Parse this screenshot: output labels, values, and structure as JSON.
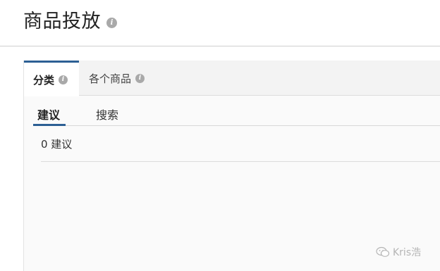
{
  "header": {
    "title": "商品投放",
    "info_icon": "info-icon"
  },
  "tabs": [
    {
      "label": "分类",
      "active": true,
      "icon": "info-icon"
    },
    {
      "label": "各个商品",
      "active": false,
      "icon": "info-icon"
    }
  ],
  "subtabs": [
    {
      "label": "建议",
      "active": true
    },
    {
      "label": "搜索",
      "active": false
    }
  ],
  "results": {
    "summary": "0 建议"
  },
  "watermark": {
    "text": "Kris浩",
    "icon": "wechat-icon"
  },
  "colors": {
    "accent": "#2c5f94",
    "info_icon": "#a9a9a9",
    "panel_bg": "#fafafa",
    "tab_bar_bg": "#f3f3f3"
  }
}
